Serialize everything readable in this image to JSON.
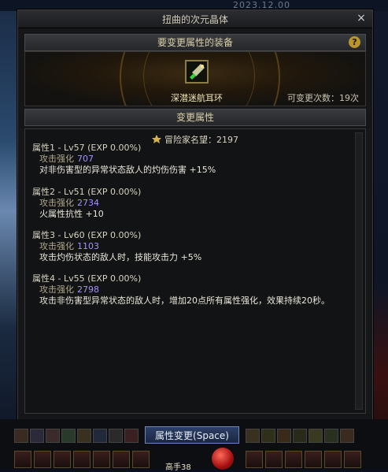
{
  "window": {
    "title": "扭曲的次元晶体",
    "close_symbol": "×"
  },
  "background": {
    "date_text": "2023.12.00"
  },
  "equip_section": {
    "header": "要变更属性的装备",
    "help_symbol": "?",
    "item_name": "深潜迷航耳环",
    "change_count": "可变更次数：19次"
  },
  "attr_section": {
    "header": "变更属性",
    "fame": "冒险家名望：2197",
    "attributes": [
      {
        "title": "属性1 - Lv57 (EXP 0.00%)",
        "sub_label": "攻击强化",
        "sub_value": "707",
        "effect": "对非伤害型的异常状态敌人的灼伤伤害 +15%"
      },
      {
        "title": "属性2 - Lv51 (EXP 0.00%)",
        "sub_label": "攻击强化",
        "sub_value": "2734",
        "effect": "火属性抗性 +10"
      },
      {
        "title": "属性3 - Lv60 (EXP 0.00%)",
        "sub_label": "攻击强化",
        "sub_value": "1103",
        "effect": "攻击灼伤状态的敌人时，技能攻击力 +5%"
      },
      {
        "title": "属性4 - Lv55 (EXP 0.00%)",
        "sub_label": "攻击强化",
        "sub_value": "2798",
        "effect": "攻击非伤害型异常状态的敌人时，增加20点所有属性强化，效果持续20秒。"
      }
    ]
  },
  "actions": {
    "change_button": "属性变更(Space)"
  },
  "hud": {
    "mode_label": "高手38",
    "hp_percent": "100%"
  },
  "colors": {
    "accent_purple": "#a58fff",
    "title_gold": "#d9cfa8",
    "button_blue": "#2d3f66"
  }
}
